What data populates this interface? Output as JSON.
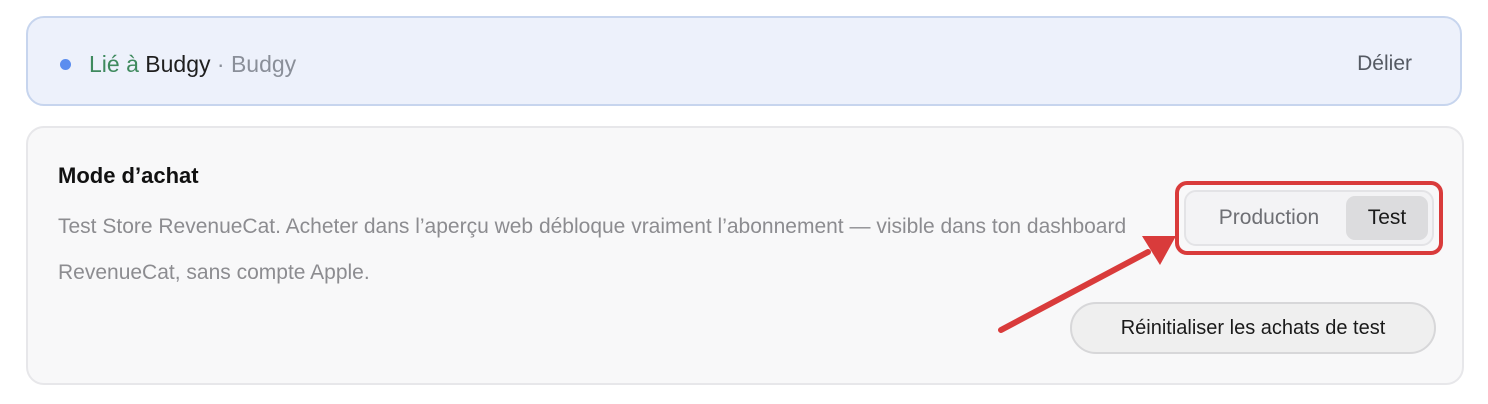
{
  "linked": {
    "prefix": "Lié à",
    "app_name": "Budgy",
    "separator": "·",
    "subtitle": "Budgy",
    "unlink_label": "Délier",
    "dot_color": "#5b8def"
  },
  "purchase_mode": {
    "title": "Mode d’achat",
    "description": "Test Store RevenueCat. Acheter dans l’aperçu web débloque vraiment l’abonnement — visible dans ton dashboard RevenueCat, sans compte Apple.",
    "options": [
      {
        "label": "Production",
        "selected": false
      },
      {
        "label": "Test",
        "selected": true
      }
    ],
    "reset_label": "Réinitialiser les achats de test"
  },
  "annotation": {
    "color": "#d93b3b",
    "shapes": [
      "highlight-box",
      "arrow"
    ]
  }
}
